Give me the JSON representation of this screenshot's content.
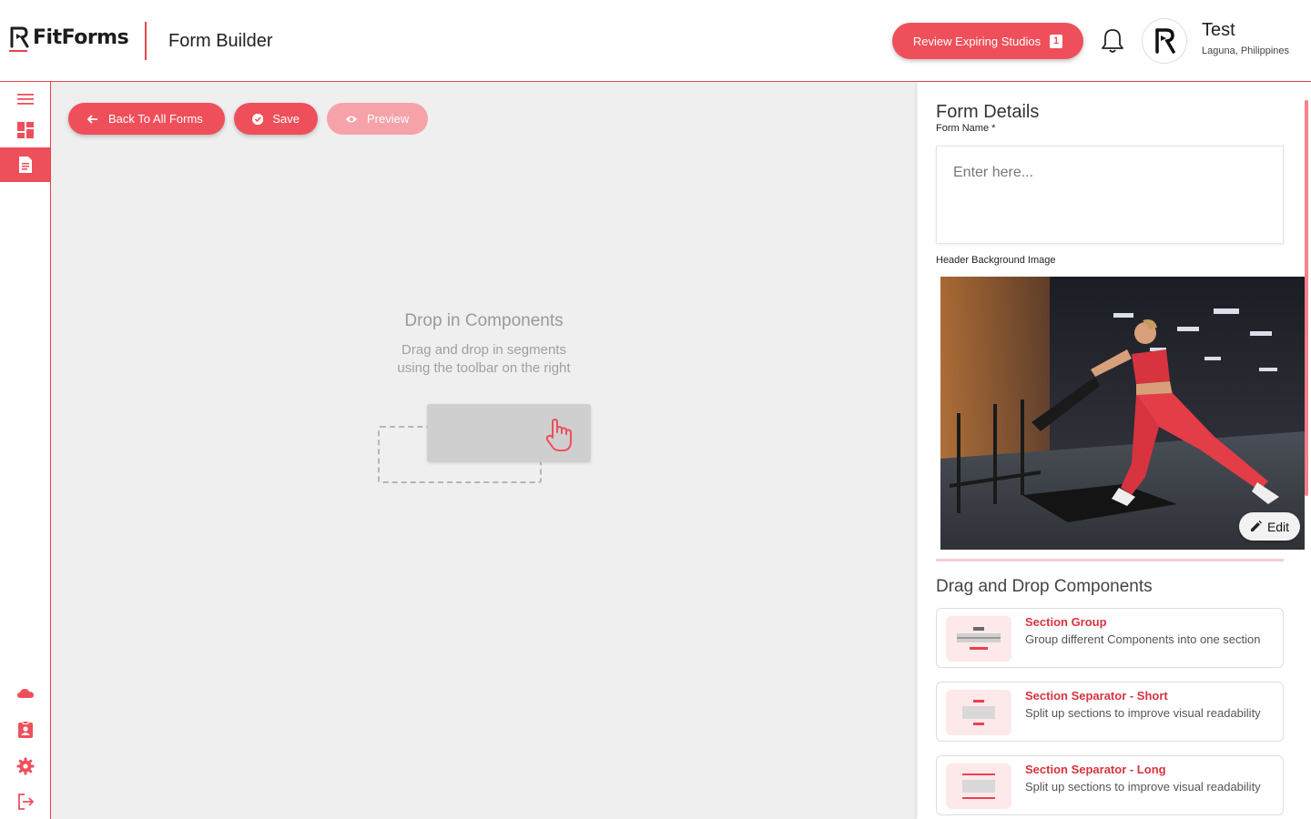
{
  "app": {
    "logo_text": "FitForms",
    "page_title": "Form Builder"
  },
  "header": {
    "review_label": "Review Expiring Studios",
    "review_count": "1",
    "user_name": "Test",
    "user_location": "Laguna, Philippines"
  },
  "sidebar": {
    "top_items": [
      "menu-icon",
      "dashboard-icon",
      "form-icon"
    ],
    "bottom_items": [
      "cloud-icon",
      "contact-badge-icon",
      "settings-icon",
      "logout-icon"
    ],
    "active_item": "form-icon"
  },
  "toolbar": {
    "back_label": "Back To All Forms",
    "save_label": "Save",
    "preview_label": "Preview"
  },
  "canvas": {
    "drop_title": "Drop in Components",
    "drop_line1": "Drag and drop in segments",
    "drop_line2": "using the toolbar on the right"
  },
  "panel": {
    "title": "Form Details",
    "form_name_label": "Form Name *",
    "form_name_placeholder": "Enter here...",
    "form_name_value": "",
    "header_image_label": "Header Background Image",
    "edit_label": "Edit",
    "dnd_title": "Drag and Drop Components",
    "components": [
      {
        "title": "Section Group",
        "desc": "Group different Components into one section"
      },
      {
        "title": "Section Separator - Short",
        "desc": "Split up sections to improve visual readability"
      },
      {
        "title": "Section Separator - Long",
        "desc": "Split up sections to improve visual readability"
      }
    ]
  },
  "colors": {
    "accent": "#ef4f5b",
    "accent_light": "#f5a3a9",
    "canvas_bg": "#efefef"
  }
}
